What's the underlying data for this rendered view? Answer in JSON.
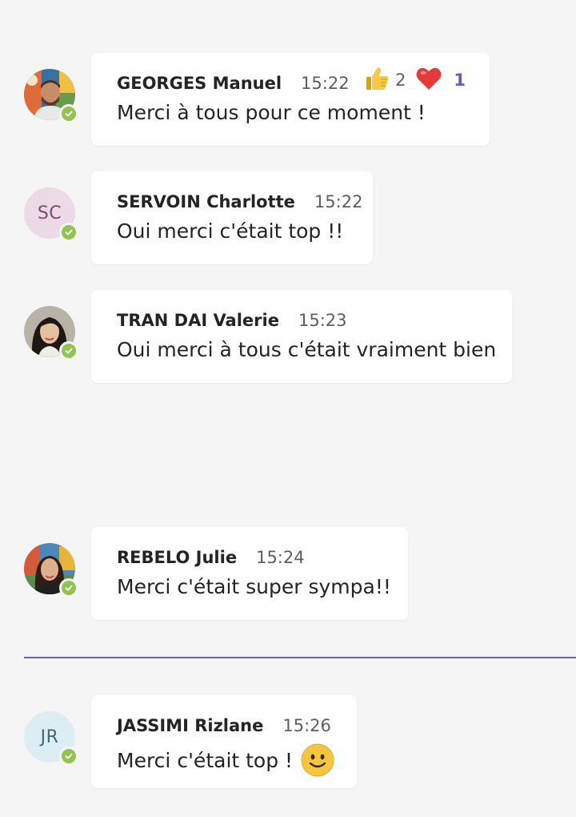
{
  "messages": [
    {
      "author": "GEORGES Manuel",
      "time": "15:22",
      "text": "Merci à tous pour ce moment !",
      "avatar": {
        "type": "photo",
        "icon": "user-photo"
      },
      "presence": "available",
      "reactions": [
        {
          "icon": "thumbs-up-icon",
          "count": "2"
        },
        {
          "icon": "heart-icon",
          "count": "1"
        }
      ]
    },
    {
      "author": "SERVOIN Charlotte",
      "time": "15:22",
      "text": "Oui merci c'était top !!",
      "avatar": {
        "type": "initials",
        "initials": "SC",
        "bg": "#ecdae7",
        "fg": "#7a4d6e"
      },
      "presence": "available"
    },
    {
      "author": "TRAN DAI Valerie",
      "time": "15:23",
      "text": "Oui merci à tous c'était vraiment bien",
      "avatar": {
        "type": "photo",
        "icon": "user-photo"
      },
      "presence": "available"
    },
    {
      "author": "REBELO Julie",
      "time": "15:24",
      "text": "Merci c'était super sympa!!",
      "avatar": {
        "type": "photo",
        "icon": "user-photo"
      },
      "presence": "available"
    },
    {
      "author": "JASSIMI Rizlane",
      "time": "15:26",
      "text": "Merci c'était top !",
      "emoji": "smile-emoji-icon",
      "avatar": {
        "type": "initials",
        "initials": "JR",
        "bg": "#dcedf3",
        "fg": "#3d6b79"
      },
      "presence": "available"
    }
  ],
  "colors": {
    "background": "#f5f5f5",
    "presence_available": "#92c353",
    "divider": "#6264a7",
    "own_reaction": "#5b5fc7"
  }
}
